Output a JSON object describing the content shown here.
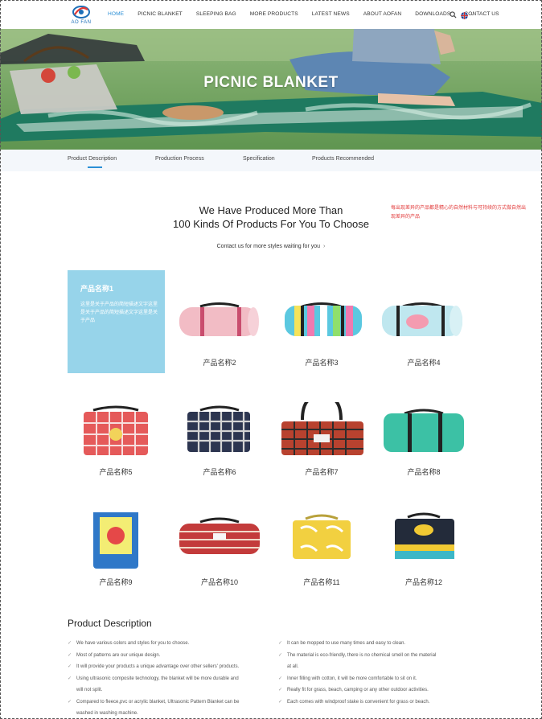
{
  "header": {
    "logo_text": "AO FAN",
    "nav": [
      {
        "label": "HOME",
        "active": true
      },
      {
        "label": "PICNIC BLANKET",
        "active": false
      },
      {
        "label": "SLEEPING BAG",
        "active": false
      },
      {
        "label": "MORE PRODUCTS",
        "active": false
      },
      {
        "label": "LATEST NEWS",
        "active": false
      },
      {
        "label": "ABOUT AOFAN",
        "active": false
      },
      {
        "label": "DOWNLOADS",
        "active": false
      },
      {
        "label": "CONTACT US",
        "active": false
      }
    ],
    "icons": [
      "search-icon",
      "language-flag-icon",
      "chevron-down-icon"
    ]
  },
  "banner": {
    "title": "PICNIC BLANKET"
  },
  "tabs": [
    "Product Description",
    "Production Process",
    "Specification",
    "Products Recommended"
  ],
  "intro": {
    "headline_line1": "We Have Produced More Than",
    "headline_line2": "100 Kinds Of Products For You To Choose",
    "note": "每出现差异的产品都是精心的自然材料与可持续的方式做自然出现差异的产品",
    "contact": "Contact us for more styles waiting for you",
    "contact_arrow": "›"
  },
  "featured": {
    "title": "产品名称1",
    "desc": "这里是关于产品的简短描述文字这里是关于产品的简短描述文字这里是关于产品"
  },
  "products": [
    {
      "name": "产品名称2"
    },
    {
      "name": "产品名称3"
    },
    {
      "name": "产品名称4"
    },
    {
      "name": "产品名称5"
    },
    {
      "name": "产品名称6"
    },
    {
      "name": "产品名称7"
    },
    {
      "name": "产品名称8"
    },
    {
      "name": "产品名称9"
    },
    {
      "name": "产品名称10"
    },
    {
      "name": "产品名称11"
    },
    {
      "name": "产品名称12"
    }
  ],
  "description": {
    "heading": "Product Description",
    "left": [
      "We have various colors and styles for you to choose.",
      "Most of patterns are our unique design.",
      "It will provide your products a unique advantage over other sellers' products.",
      "Using ultrasonic composite technology, the blanket will be more durable and",
      "will not split.",
      "Compared to fleece,pvc or acrylic blanket, Ultrasonic Pattern Blanket can be",
      "washed in washing machine."
    ],
    "right": [
      "It can be mopped to use many times and easy to clean.",
      "The material is eco-friendly, there is no chemical smell on the material",
      "at all.",
      "Inner filling with cotton, it will be more comfortable to sit on it.",
      "Really fit for grass, beach, camping or any other outdoor activities.",
      "Each comes with windproof stake is convenient for grass or beach."
    ]
  },
  "colors": {
    "accent": "#2b8fd6",
    "feature_box": "#97d4ea",
    "note_red": "#e23b3b"
  }
}
